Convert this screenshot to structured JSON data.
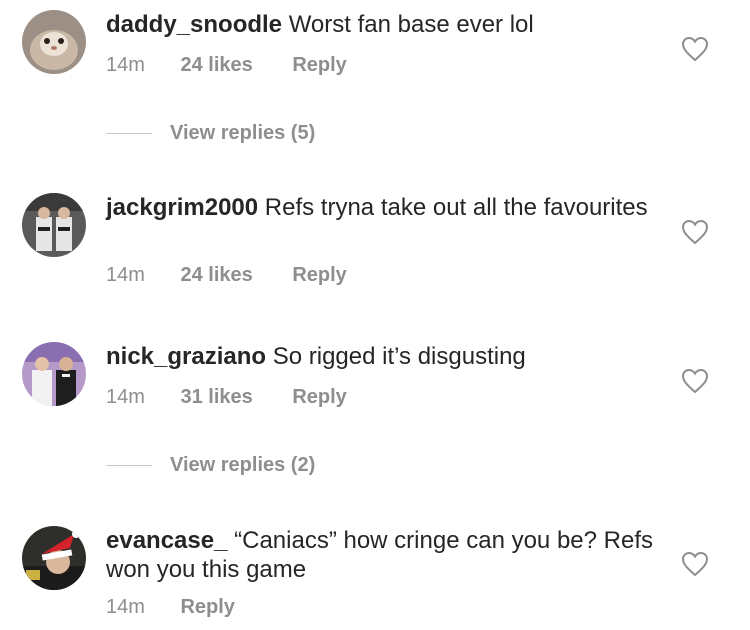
{
  "comments": [
    {
      "username": "daddy_snoodle",
      "text": "Worst fan base ever lol",
      "time": "14m",
      "likes": "24 likes",
      "reply": "Reply"
    },
    {
      "username": "jackgrim2000",
      "text": "Refs tryna take out all the favourites",
      "time": "14m",
      "likes": "24 likes",
      "reply": "Reply"
    },
    {
      "username": "nick_graziano",
      "text": "So rigged it’s disgusting",
      "time": "14m",
      "likes": "31 likes",
      "reply": "Reply"
    },
    {
      "username": "evancase_",
      "text": "“Caniacs” how cringe can you be? Refs won you this game",
      "time": "14m",
      "reply": "Reply"
    }
  ],
  "view_replies": [
    "View replies (5)",
    "View replies (2)"
  ],
  "icons": {
    "like": "heart-outline-icon"
  },
  "colors": {
    "text": "#262626",
    "secondary": "#8e8e8e"
  }
}
